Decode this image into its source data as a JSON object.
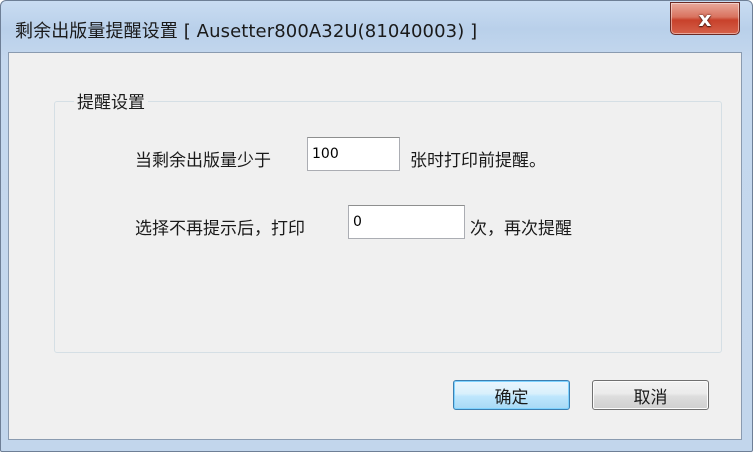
{
  "window": {
    "title": "剩余出版量提醒设置 [ Ausetter800A32U(81040003) ]",
    "close_symbol": "x",
    "close_icon_name": "close-icon"
  },
  "group": {
    "title": "提醒设置"
  },
  "row1": {
    "prefix": "当剩余出版量少于",
    "value": "100",
    "suffix": "张时打印前提醒。"
  },
  "row2": {
    "prefix": "选择不再提示后，打印",
    "value": "0",
    "suffix": "次，再次提醒"
  },
  "buttons": {
    "ok_label": "确定",
    "cancel_label": "取消"
  },
  "colors": {
    "title_bar": "#c9dcf2",
    "client_background": "#f0f0f0",
    "close_button": "#c8412b",
    "default_button_border": "#3c7fb1"
  }
}
